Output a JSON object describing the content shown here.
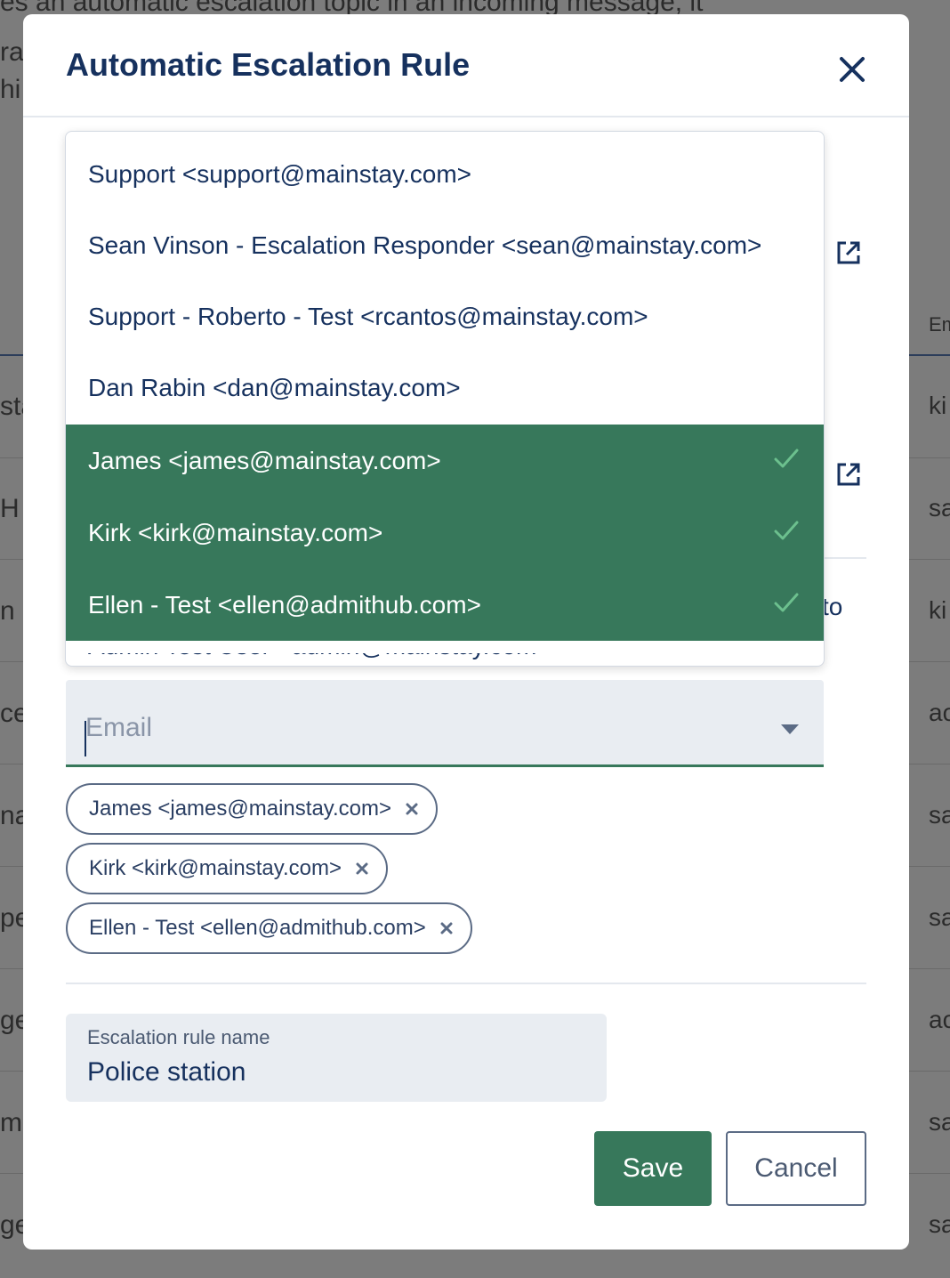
{
  "background": {
    "top_text": "es an automatic escalation topic in an incoming message, it",
    "left_fragments": [
      "ra",
      "hi",
      "sta",
      "H",
      "n",
      "ce",
      "na",
      "pe",
      "ge",
      "m",
      "ge"
    ],
    "right_fragments": [
      "Em",
      "ki",
      "sa",
      "ki",
      "ac",
      "sa",
      "sa",
      "ac",
      "sa",
      "sa"
    ]
  },
  "modal": {
    "title": "Automatic Escalation Rule",
    "close_icon": "close-icon",
    "partial_text_to": "to"
  },
  "dropdown": {
    "options": [
      {
        "label": "Support <support@mainstay.com>",
        "selected": false
      },
      {
        "label": "Sean Vinson - Escalation Responder <sean@mainstay.com>",
        "selected": false
      },
      {
        "label": "Support - Roberto - Test <rcantos@mainstay.com>",
        "selected": false
      },
      {
        "label": "Dan Rabin <dan@mainstay.com>",
        "selected": false
      },
      {
        "label": "James <james@mainstay.com>",
        "selected": true
      },
      {
        "label": "Kirk <kirk@mainstay.com>",
        "selected": true
      },
      {
        "label": "Ellen - Test <ellen@admithub.com>",
        "selected": true
      }
    ],
    "partial_option": "Admin Test User <admin@mainstay.com>",
    "selected_bg": "#37785b"
  },
  "email_field": {
    "placeholder": "Email",
    "value": ""
  },
  "chips": [
    {
      "label": "James <james@mainstay.com>"
    },
    {
      "label": "Kirk <kirk@mainstay.com>"
    },
    {
      "label": "Ellen - Test <ellen@admithub.com>"
    }
  ],
  "rule_name": {
    "label": "Escalation rule name",
    "value": "Police station"
  },
  "buttons": {
    "save": "Save",
    "cancel": "Cancel"
  },
  "colors": {
    "primary_green": "#37785b",
    "text_navy": "#16315e",
    "field_bg": "#e9edf2"
  }
}
